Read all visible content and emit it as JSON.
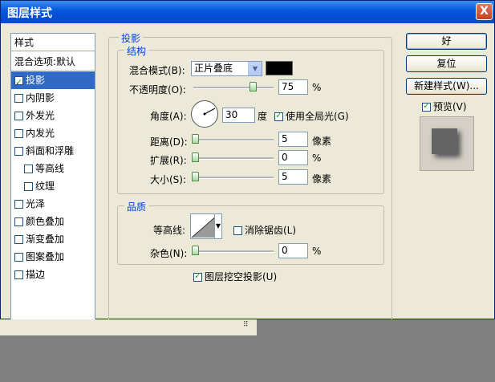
{
  "window": {
    "title": "图层样式",
    "close": "X"
  },
  "style_list": {
    "header": "样式",
    "blend_options": "混合选项:默认",
    "items": [
      {
        "label": "投影",
        "checked": true,
        "selected": true,
        "indent": false
      },
      {
        "label": "内阴影",
        "checked": false,
        "selected": false,
        "indent": false
      },
      {
        "label": "外发光",
        "checked": false,
        "selected": false,
        "indent": false
      },
      {
        "label": "内发光",
        "checked": false,
        "selected": false,
        "indent": false
      },
      {
        "label": "斜面和浮雕",
        "checked": false,
        "selected": false,
        "indent": false
      },
      {
        "label": "等高线",
        "checked": false,
        "selected": false,
        "indent": true
      },
      {
        "label": "纹理",
        "checked": false,
        "selected": false,
        "indent": true
      },
      {
        "label": "光泽",
        "checked": false,
        "selected": false,
        "indent": false
      },
      {
        "label": "颜色叠加",
        "checked": false,
        "selected": false,
        "indent": false
      },
      {
        "label": "渐变叠加",
        "checked": false,
        "selected": false,
        "indent": false
      },
      {
        "label": "图案叠加",
        "checked": false,
        "selected": false,
        "indent": false
      },
      {
        "label": "描边",
        "checked": false,
        "selected": false,
        "indent": false
      }
    ]
  },
  "drop_shadow": {
    "section_title": "投影",
    "structure_title": "结构",
    "blend_mode_label": "混合模式(B):",
    "blend_mode_value": "正片叠底",
    "color": "#000000",
    "opacity_label": "不透明度(O):",
    "opacity_value": "75",
    "opacity_unit": "%",
    "angle_label": "角度(A):",
    "angle_value": "30",
    "angle_unit": "度",
    "global_light_label": "使用全局光(G)",
    "global_light_checked": true,
    "distance_label": "距离(D):",
    "distance_value": "5",
    "distance_unit": "像素",
    "spread_label": "扩展(R):",
    "spread_value": "0",
    "spread_unit": "%",
    "size_label": "大小(S):",
    "size_value": "5",
    "size_unit": "像素",
    "quality_title": "品质",
    "contour_label": "等高线:",
    "antialias_label": "消除锯齿(L)",
    "antialias_checked": false,
    "noise_label": "杂色(N):",
    "noise_value": "0",
    "noise_unit": "%",
    "knockout_label": "图层挖空投影(U)",
    "knockout_checked": true
  },
  "buttons": {
    "ok": "好",
    "reset": "复位",
    "new_style": "新建样式(W)...",
    "preview_label": "预览(V)",
    "preview_checked": true
  }
}
